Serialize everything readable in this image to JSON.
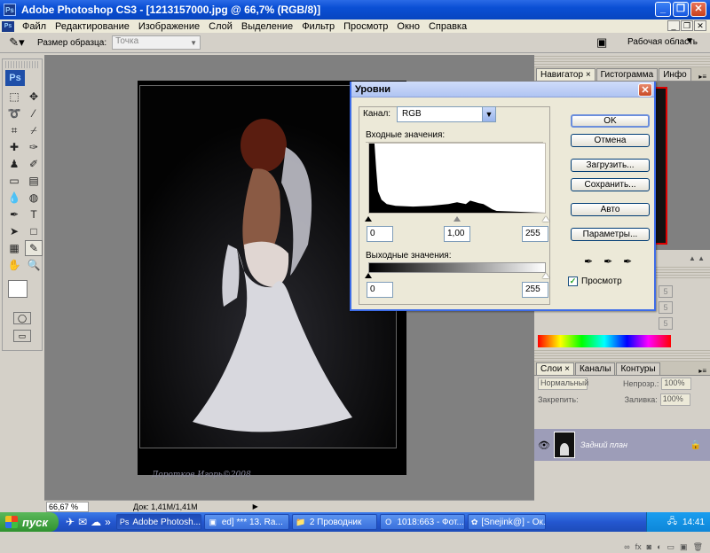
{
  "window": {
    "title": "Adobe Photoshop CS3 - [1213157000.jpg @ 66,7% (RGB/8)]",
    "app_icon": "Ps"
  },
  "menu": [
    "Файл",
    "Редактирование",
    "Изображение",
    "Слой",
    "Выделение",
    "Фильтр",
    "Просмотр",
    "Окно",
    "Справка"
  ],
  "options_bar": {
    "sample_size_label": "Размер образца:",
    "sample_size_value": "Точка",
    "workspace_label": "Рабочая область"
  },
  "toolbox": {
    "logo": "Ps"
  },
  "canvas": {
    "signature": "Доротков Игорь©2008"
  },
  "status": {
    "zoom": "66,67 %",
    "doc_info": "Док: 1,41M/1,41M"
  },
  "panels": {
    "nav_tabs": [
      "Навигатор ×",
      "Гистограмма",
      "Инфо"
    ],
    "color_values": [
      "5",
      "5",
      "5"
    ],
    "layers_tabs": [
      "Слои ×",
      "Каналы",
      "Контуры"
    ],
    "blend_mode": "Нормальный",
    "opacity_label": "Непрозр.:",
    "opacity_value": "100%",
    "lock_label": "Закрепить:",
    "fill_label": "Заливка:",
    "fill_value": "100%",
    "layer_name": "Задний план"
  },
  "dialog": {
    "title": "Уровни",
    "channel_label": "Канал:",
    "channel_value": "RGB",
    "input_label": "Входные значения:",
    "input_black": "0",
    "input_gamma": "1,00",
    "input_white": "255",
    "output_label": "Выходные значения:",
    "output_black": "0",
    "output_white": "255",
    "buttons": {
      "ok": "OK",
      "cancel": "Отмена",
      "load": "Загрузить...",
      "save": "Сохранить...",
      "auto": "Авто",
      "options": "Параметры..."
    },
    "preview_label": "Просмотр",
    "preview_checked": true
  },
  "taskbar": {
    "start": "пуск",
    "tasks": [
      "Adobe Photosh...",
      "ed] *** 13. Ra...",
      "2 Проводник",
      "1018:663 - Фот...",
      "[Snejink@] - Ок..."
    ],
    "clock": "14:41"
  }
}
